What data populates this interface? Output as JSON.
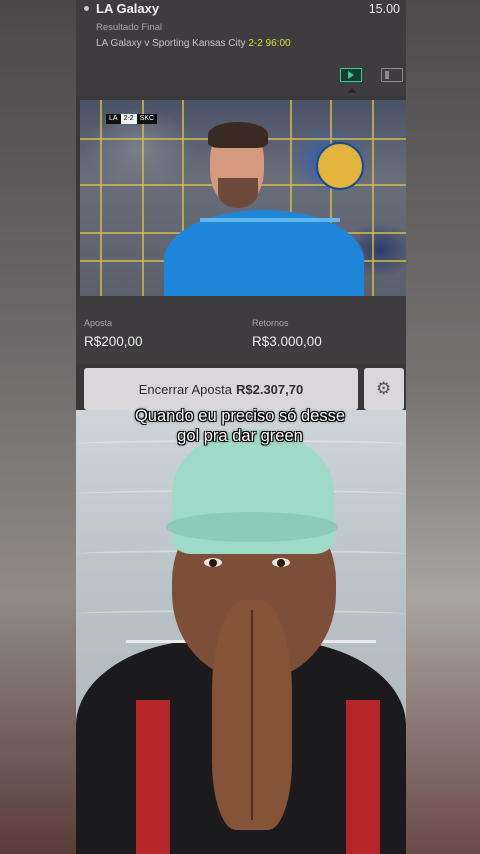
{
  "bet": {
    "team": "LA Galaxy",
    "odds": "15.00",
    "result_label": "Resultado Final",
    "match": "LA Galaxy v Sporting Kansas City",
    "score": "2-2",
    "minute": "96:00"
  },
  "video": {
    "scorebug_home": "LA",
    "scorebug_score": "2-2",
    "scorebug_away": "SKC"
  },
  "stake": {
    "label": "Aposta",
    "value": "R$200,00"
  },
  "returns": {
    "label": "Retornos",
    "value": "R$3.000,00"
  },
  "cashout": {
    "label": "Encerrar Aposta",
    "amount": "R$2.307,70"
  },
  "caption": {
    "line1": "Quando eu preciso só desse",
    "line2": "gol pra dar green"
  },
  "colors": {
    "accent": "#d8e23a",
    "stream": "#2bd19a",
    "panel": "#3f3c3f"
  },
  "icons": {
    "stream": "tv-icon",
    "stats": "list-icon",
    "settings": "gear-icon"
  }
}
